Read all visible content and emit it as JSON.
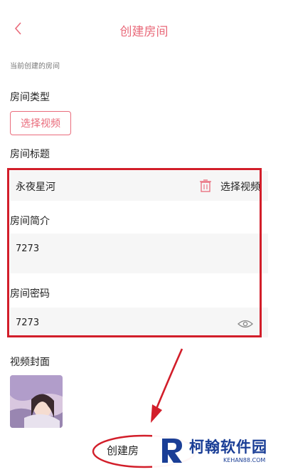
{
  "header": {
    "title": "创建房间"
  },
  "section": {
    "current_label": "当前创建的房间"
  },
  "room_type": {
    "label": "房间类型",
    "button": "选择视频"
  },
  "room_title": {
    "label": "房间标题",
    "value": "永夜星河",
    "action": "选择视频"
  },
  "room_intro": {
    "label": "房间简介",
    "value": "7273"
  },
  "room_password": {
    "label": "房间密码",
    "value": "7273"
  },
  "cover": {
    "label": "视频封面"
  },
  "footer": {
    "create_label": "创建房"
  },
  "watermark": {
    "brand": "柯翰软件园",
    "site": "KEHAN88.COM"
  },
  "colors": {
    "accent": "#e96a7a",
    "annotation_red": "#d21e2a"
  }
}
